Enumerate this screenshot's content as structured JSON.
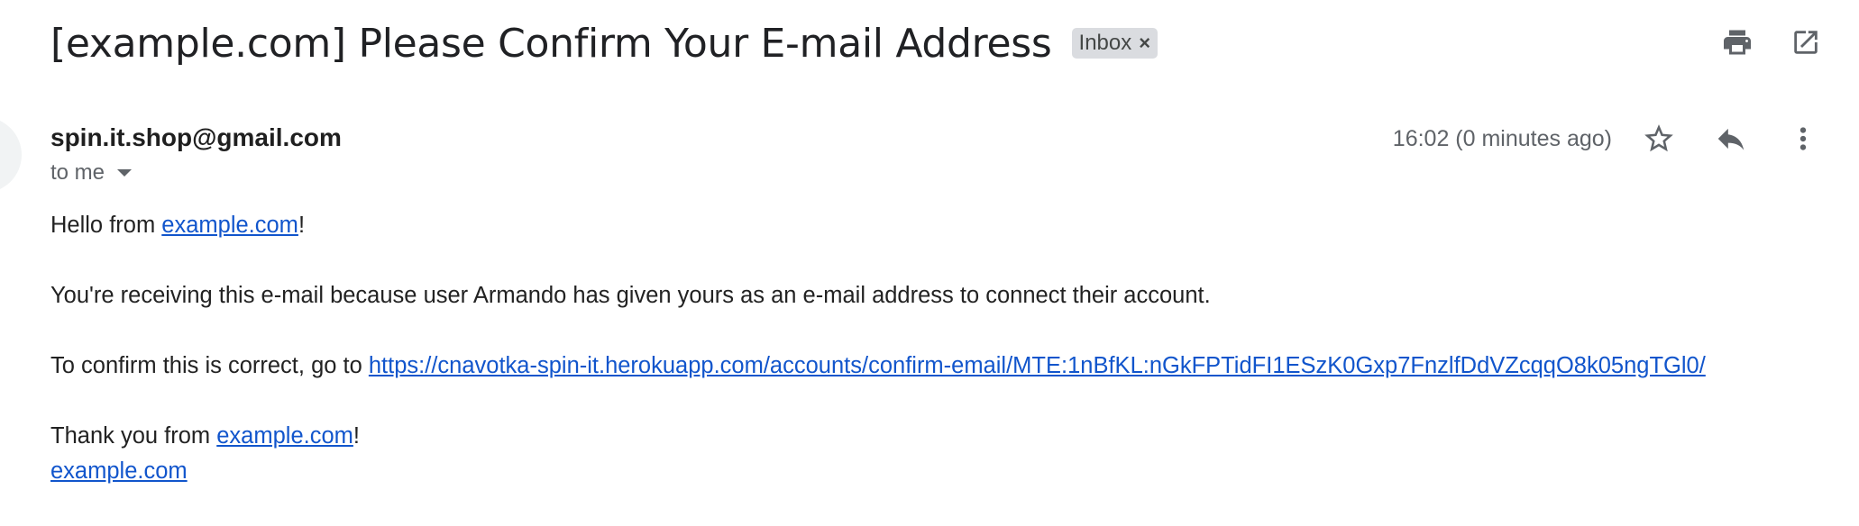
{
  "header": {
    "subject": "[example.com] Please Confirm Your E-mail Address",
    "label": "Inbox",
    "label_remove": "×",
    "actions": [
      "print-icon",
      "open-in-new-window-icon"
    ]
  },
  "message": {
    "sender": "spin.it.shop@gmail.com",
    "recipient": "to me",
    "timestamp": "16:02 (0 minutes ago)",
    "actions": [
      "star-icon",
      "reply-icon",
      "more-vert-icon"
    ],
    "body": {
      "greeting_prefix": "Hello from ",
      "greeting_link": "example.com",
      "greeting_suffix": "!",
      "paragraph": "You're receiving this e-mail because user Armando has given yours as an e-mail address to connect their account.",
      "confirm_prefix": "To confirm this is correct, go to ",
      "confirm_link": "https://cnavotka-spin-it.herokuapp.com/accounts/confirm-email/MTE:1nBfKL:nGkFPTidFI1ESzK0Gxp7FnzlfDdVZcqqO8k05ngTGl0/",
      "thanks_prefix": "Thank you from ",
      "thanks_link": "example.com",
      "thanks_suffix": "!",
      "signature_link": "example.com"
    }
  },
  "colors": {
    "link": "#1155cc",
    "chip_bg": "#dadce0",
    "icon": "#5f6368"
  }
}
